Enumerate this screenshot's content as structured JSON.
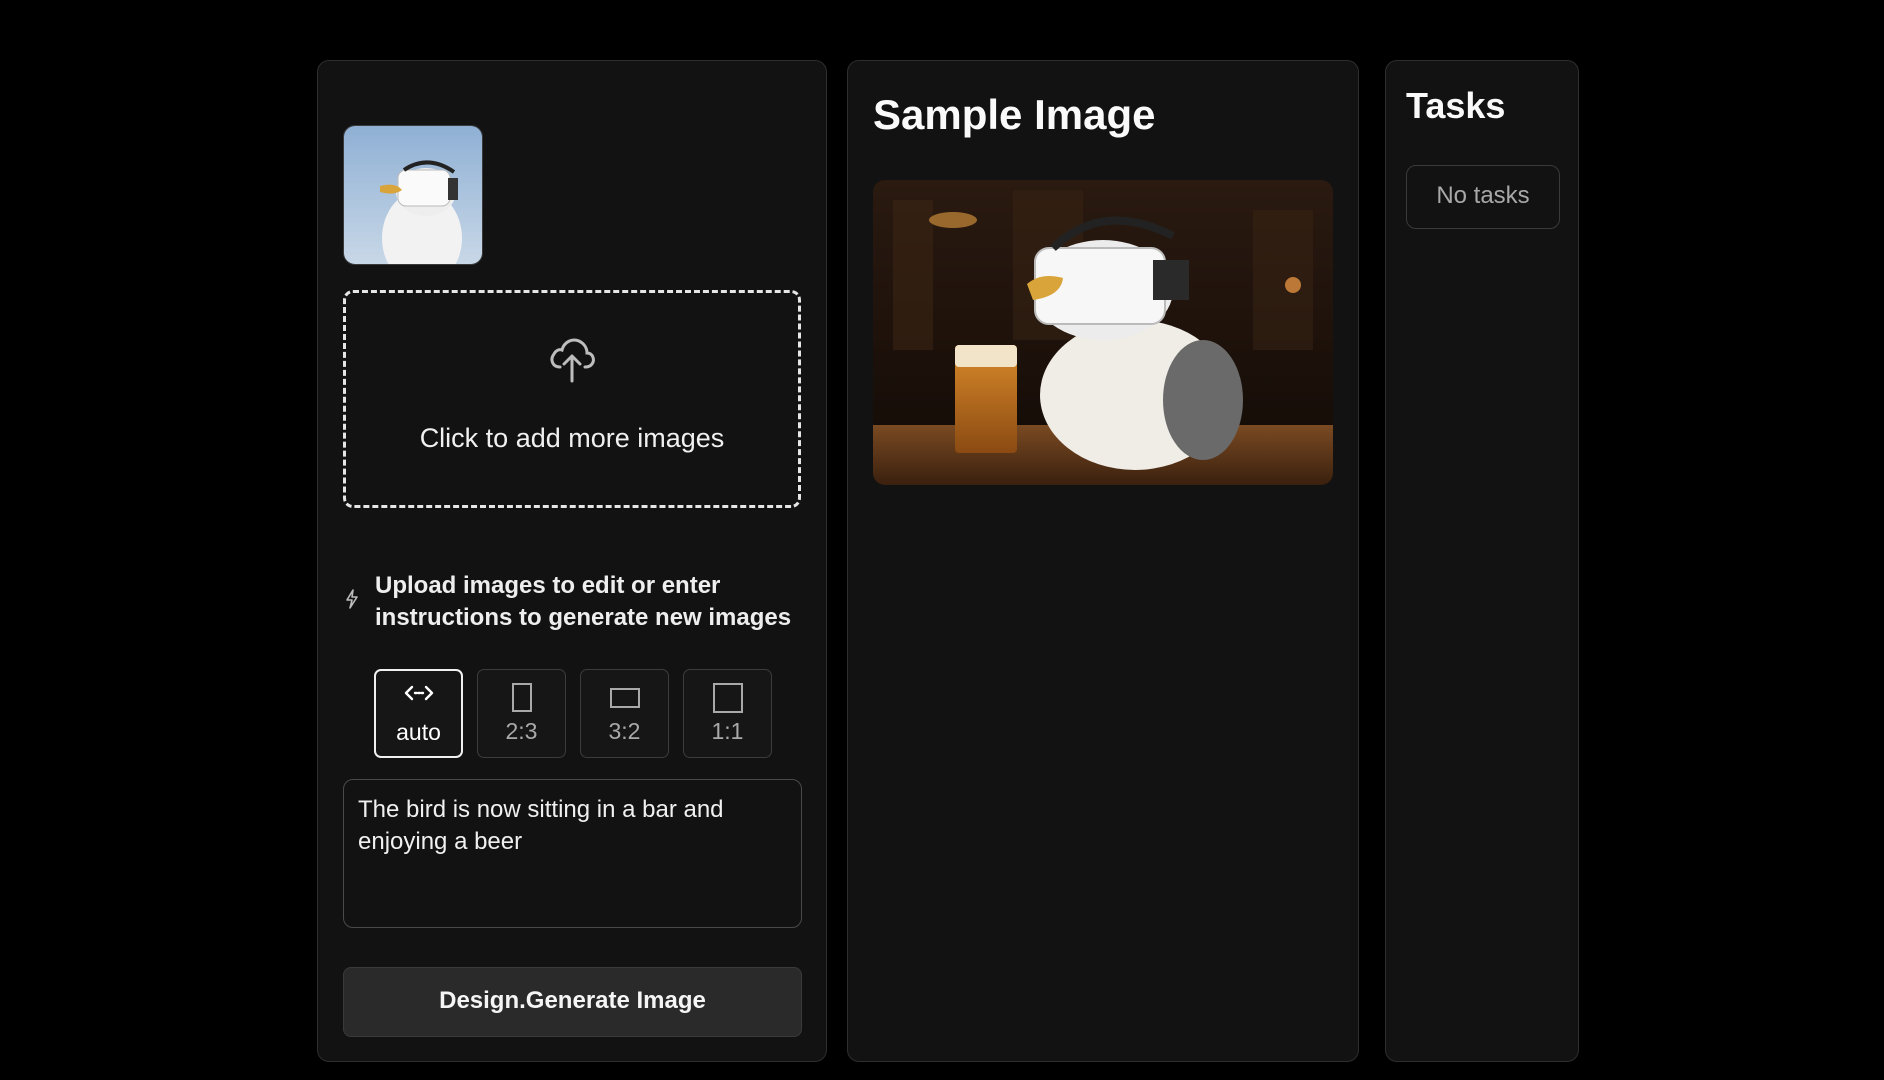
{
  "editor": {
    "thumbnail_icon": "bird-vr-thumbnail",
    "upload_label": "Click to add more images",
    "upload_icon": "cloud-upload-icon",
    "hint_icon": "bolt-icon",
    "hint_text": "Upload images to edit or enter instructions to generate new images",
    "ratios": [
      {
        "label": "auto",
        "icon": "arrows-horizontal-icon",
        "selected": true
      },
      {
        "label": "2:3",
        "icon": "portrait-rect-icon",
        "selected": false
      },
      {
        "label": "3:2",
        "icon": "landscape-rect-icon",
        "selected": false
      },
      {
        "label": "1:1",
        "icon": "square-icon",
        "selected": false
      }
    ],
    "prompt_value": "The bird is now sitting in a bar and enjoying a beer",
    "generate_label": "Design.Generate Image"
  },
  "sample": {
    "title": "Sample Image",
    "image_icon": "bird-in-bar-image"
  },
  "tasks": {
    "title": "Tasks",
    "empty_label": "No tasks"
  },
  "colors": {
    "background": "#000000",
    "panel": "#121212",
    "border": "#2e2e2e",
    "button": "#2a2a2a"
  }
}
